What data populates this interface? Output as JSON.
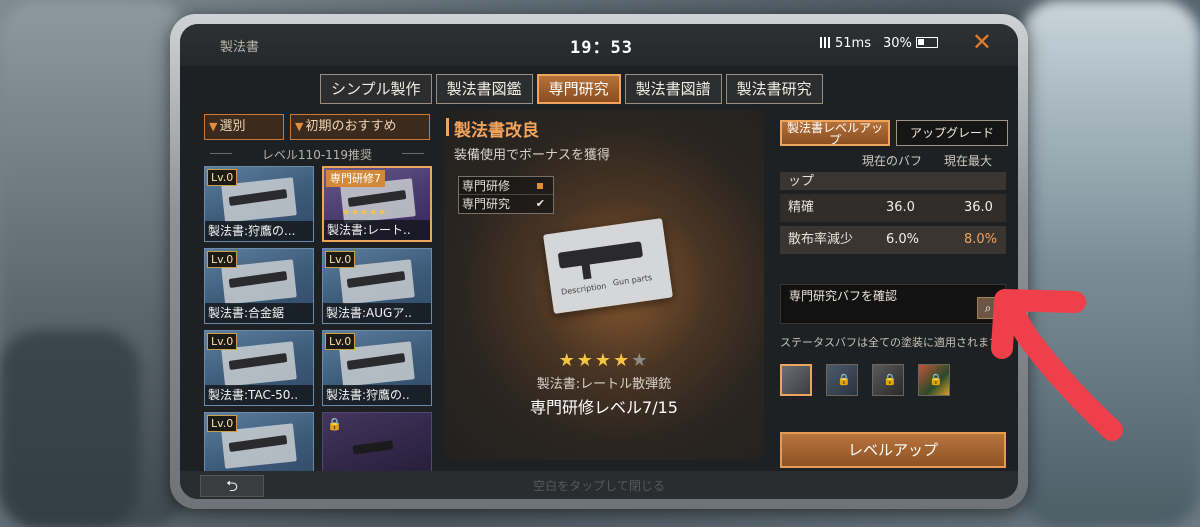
{
  "topbar": {
    "title": "製法書",
    "time": "19：53",
    "ping": "51ms",
    "battery": "30%",
    "close_icon": "close-icon"
  },
  "tabs": [
    {
      "label": "シンプル製作",
      "active": false
    },
    {
      "label": "製法書図鑑",
      "active": false
    },
    {
      "label": "専門研究",
      "active": true
    },
    {
      "label": "製法書図譜",
      "active": false
    },
    {
      "label": "製法書研究",
      "active": false
    }
  ],
  "left": {
    "filter_select": "選別",
    "filter_recommend": "初期のおすすめ",
    "level_range": "レベル110-119推奨",
    "cards": [
      {
        "level": "Lv.0",
        "name": "製法書:狩鷹の..."
      },
      {
        "tag": "専門研修7",
        "name": "製法書:レート..",
        "selected": true
      },
      {
        "level": "Lv.0",
        "name": "製法書:合金鋸"
      },
      {
        "level": "Lv.0",
        "name": "製法書:AUGア.."
      },
      {
        "level": "Lv.0",
        "name": "製法書:TAC-50.."
      },
      {
        "level": "Lv.0",
        "name": "製法書:狩鷹の.."
      },
      {
        "level": "Lv.0",
        "name": ""
      },
      {
        "locked": true,
        "name": ""
      }
    ]
  },
  "center": {
    "title": "製法書改良",
    "subtitle": "装備使用でボーナスを獲得",
    "checks": [
      {
        "label": "専門研修",
        "mark": "dot"
      },
      {
        "label": "専門研究",
        "mark": "check"
      }
    ],
    "blueprint_text_1": "Description",
    "blueprint_text_2": "Gun parts",
    "stars_filled": 4,
    "stars_total": 5,
    "item_name": "製法書:レートル散弾銃",
    "item_level": "専門研修レベル7/15"
  },
  "right": {
    "tab_levelup": "製法書レベルアップ",
    "tab_upgrade": "アップグレード",
    "col_current": "現在のバフ",
    "col_max": "現在最大",
    "partial_row": "ップ",
    "stats": [
      {
        "label": "精確",
        "current": "36.0",
        "max": "36.0",
        "highlight": false
      },
      {
        "label": "散布率減少",
        "current": "6.0%",
        "max": "8.0%",
        "highlight": true
      }
    ],
    "confirm_text": "専門研究バフを確認",
    "note": "ステータスバフは全ての塗装に適用されます",
    "levelup_button": "レベルアップ"
  },
  "bottom": {
    "back_icon": "back-arrow-icon",
    "back_glyph": "⮌",
    "hint": "空白をタップして閉じる"
  },
  "colors": {
    "accent": "#f0a35a",
    "annotation": "#ef3f4a"
  }
}
